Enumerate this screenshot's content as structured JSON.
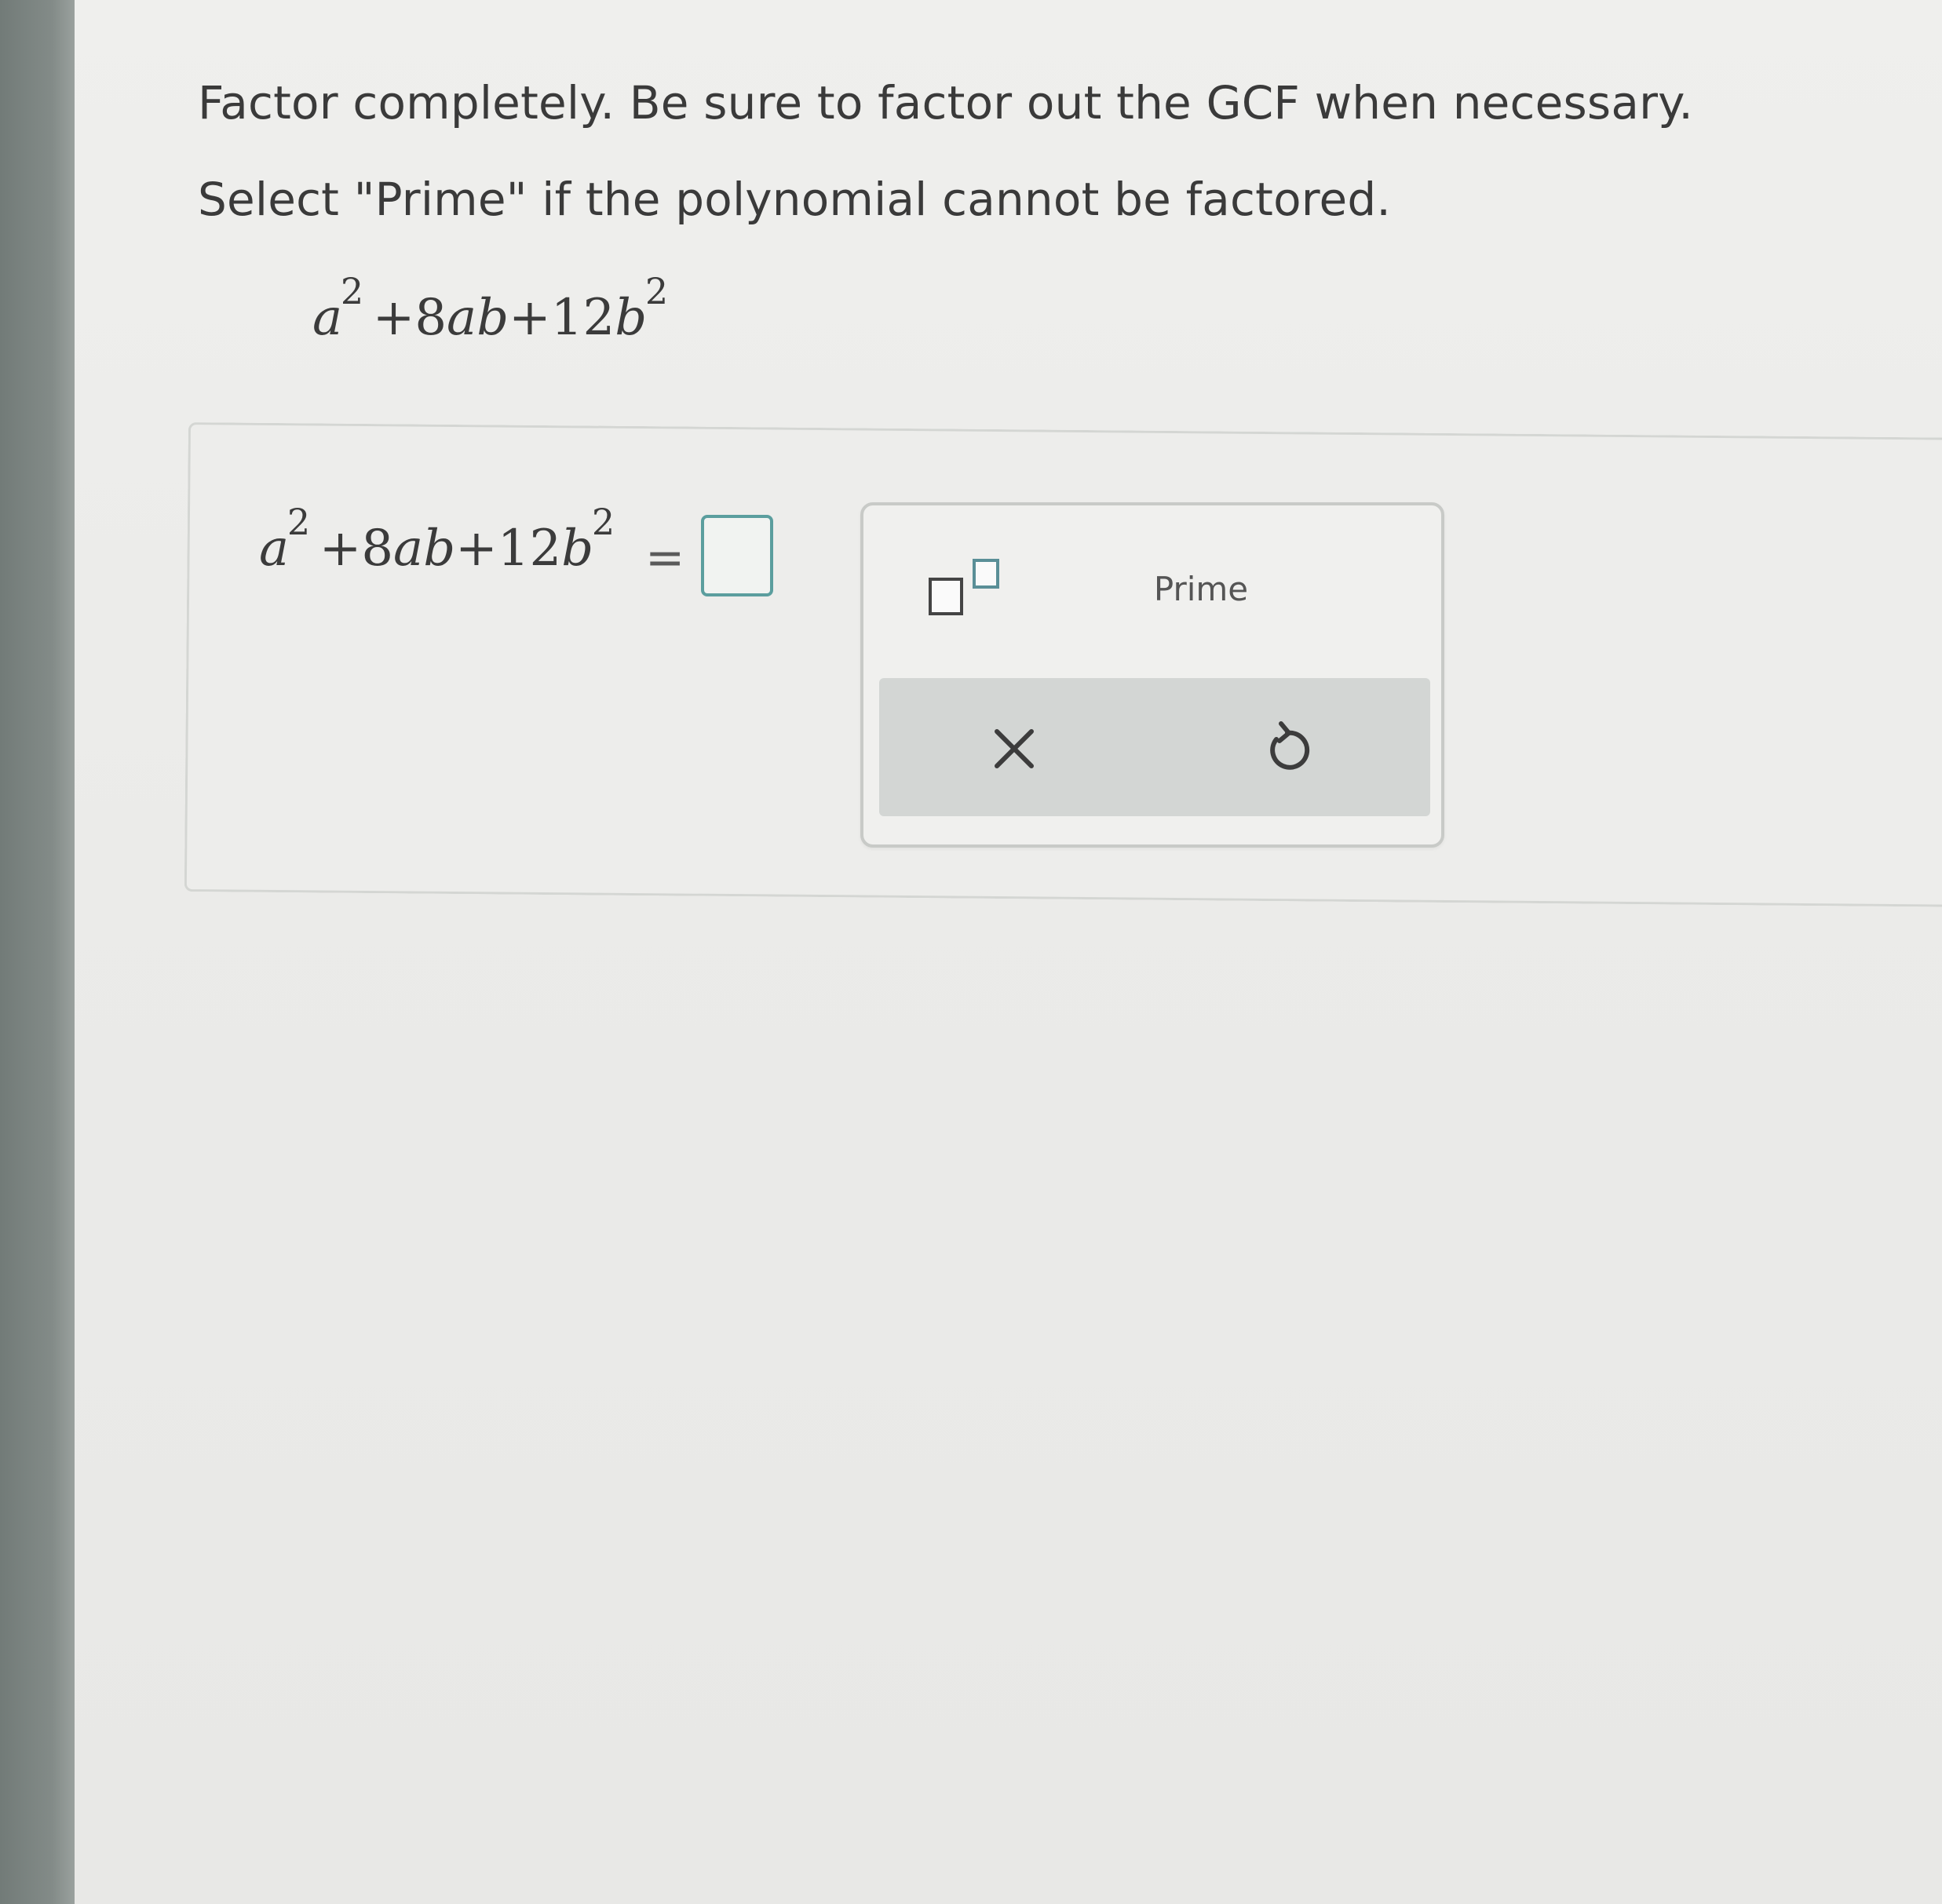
{
  "instructions": {
    "line1": "Factor completely. Be sure to factor out the GCF when necessary.",
    "line2": "Select \"Prime\" if the polynomial cannot be factored."
  },
  "problem": {
    "var_a": "a",
    "exp_a": "2",
    "middle": "+8",
    "var_ab": "ab",
    "plus_12": "+12",
    "var_b": "b",
    "exp_b": "2"
  },
  "answer": {
    "equals": "=",
    "input_value": ""
  },
  "toolbox": {
    "prime_label": "Prime",
    "clear_icon": "close-icon",
    "undo_icon": "undo-icon",
    "accent_color": "#5b9e9e"
  }
}
